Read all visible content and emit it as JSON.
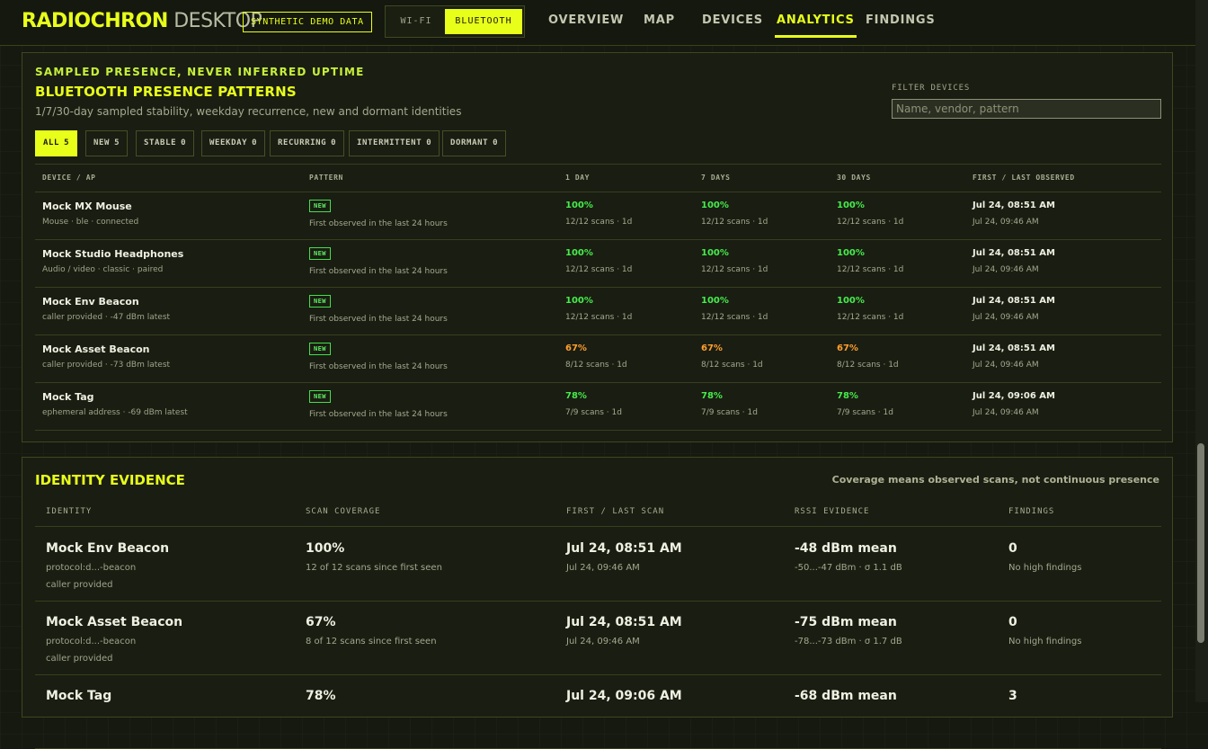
{
  "app": {
    "brand_primary": "RADIOCHRON",
    "brand_secondary": "DESKTOP",
    "demo_badge": "SYNTHETIC DEMO DATA",
    "radio_options": [
      "WI-FI",
      "BLUETOOTH"
    ],
    "radio_selected": "BLUETOOTH",
    "nav": [
      {
        "label": "OVERVIEW",
        "active": false
      },
      {
        "label": "MAP",
        "active": false
      },
      {
        "label": "DEVICES",
        "active": false
      },
      {
        "label": "ANALYTICS",
        "active": true
      },
      {
        "label": "FINDINGS",
        "active": false
      }
    ],
    "accent": "#e8ff1a",
    "good": "#46ec4c",
    "warn": "#ff9f2e"
  },
  "presence": {
    "eyebrow": "SAMPLED PRESENCE, NEVER INFERRED UPTIME",
    "title": "BLUETOOTH PRESENCE PATTERNS",
    "subtitle": "1/7/30-day sampled stability, weekday recurrence, new and dormant identities",
    "filter_label": "FILTER DEVICES",
    "filter_placeholder": "Name, vendor, pattern",
    "chips": [
      {
        "label": "ALL",
        "count": "5",
        "active": true
      },
      {
        "label": "NEW",
        "count": "5",
        "active": false
      },
      {
        "label": "STABLE",
        "count": "0",
        "active": false
      },
      {
        "label": "WEEKDAY",
        "count": "0",
        "active": false
      },
      {
        "label": "RECURRING",
        "count": "0",
        "active": false
      },
      {
        "label": "INTERMITTENT",
        "count": "0",
        "active": false
      },
      {
        "label": "DORMANT",
        "count": "0",
        "active": false
      }
    ],
    "columns": [
      "DEVICE / AP",
      "PATTERN",
      "1 DAY",
      "7 DAYS",
      "30 DAYS",
      "FIRST / LAST OBSERVED"
    ],
    "rows": [
      {
        "name": "Mock MX Mouse",
        "meta": "Mouse · ble · connected",
        "badge": "NEW",
        "pattern": "First observed in the last 24 hours",
        "d1": "100%",
        "d1s": "12/12 scans · 1d",
        "d7": "100%",
        "d7s": "12/12 scans · 1d",
        "d30": "100%",
        "d30s": "12/12 scans · 1d",
        "tone": "good",
        "first": "Jul 24, 08:51 AM",
        "last": "Jul 24, 09:46 AM"
      },
      {
        "name": "Mock Studio Headphones",
        "meta": "Audio / video · classic · paired",
        "badge": "NEW",
        "pattern": "First observed in the last 24 hours",
        "d1": "100%",
        "d1s": "12/12 scans · 1d",
        "d7": "100%",
        "d7s": "12/12 scans · 1d",
        "d30": "100%",
        "d30s": "12/12 scans · 1d",
        "tone": "good",
        "first": "Jul 24, 08:51 AM",
        "last": "Jul 24, 09:46 AM"
      },
      {
        "name": "Mock Env Beacon",
        "meta": "caller provided · -47 dBm latest",
        "badge": "NEW",
        "pattern": "First observed in the last 24 hours",
        "d1": "100%",
        "d1s": "12/12 scans · 1d",
        "d7": "100%",
        "d7s": "12/12 scans · 1d",
        "d30": "100%",
        "d30s": "12/12 scans · 1d",
        "tone": "good",
        "first": "Jul 24, 08:51 AM",
        "last": "Jul 24, 09:46 AM"
      },
      {
        "name": "Mock Asset Beacon",
        "meta": "caller provided · -73 dBm latest",
        "badge": "NEW",
        "pattern": "First observed in the last 24 hours",
        "d1": "67%",
        "d1s": "8/12 scans · 1d",
        "d7": "67%",
        "d7s": "8/12 scans · 1d",
        "d30": "67%",
        "d30s": "8/12 scans · 1d",
        "tone": "warn",
        "first": "Jul 24, 08:51 AM",
        "last": "Jul 24, 09:46 AM"
      },
      {
        "name": "Mock Tag",
        "meta": "ephemeral address · -69 dBm latest",
        "badge": "NEW",
        "pattern": "First observed in the last 24 hours",
        "d1": "78%",
        "d1s": "7/9 scans · 1d",
        "d7": "78%",
        "d7s": "7/9 scans · 1d",
        "d30": "78%",
        "d30s": "7/9 scans · 1d",
        "tone": "good",
        "first": "Jul 24, 09:06 AM",
        "last": "Jul 24, 09:46 AM"
      }
    ]
  },
  "identity": {
    "title": "IDENTITY EVIDENCE",
    "note": "Coverage means observed scans, not continuous presence",
    "columns": [
      "IDENTITY",
      "SCAN COVERAGE",
      "FIRST / LAST SCAN",
      "RSSI EVIDENCE",
      "FINDINGS"
    ],
    "rows": [
      {
        "name": "Mock Env Beacon",
        "protocol": "protocol:d...-beacon",
        "source": "caller provided",
        "coverage": "100%",
        "coverage_detail": "12 of 12 scans since first seen",
        "first": "Jul 24, 08:51 AM",
        "last": "Jul 24, 09:46 AM",
        "rssi": "-48 dBm mean",
        "rssi_detail": "-50...-47 dBm · σ 1.1 dB",
        "findings": "0",
        "findings_detail": "No high findings"
      },
      {
        "name": "Mock Asset Beacon",
        "protocol": "protocol:d...-beacon",
        "source": "caller provided",
        "coverage": "67%",
        "coverage_detail": "8 of 12 scans since first seen",
        "first": "Jul 24, 08:51 AM",
        "last": "Jul 24, 09:46 AM",
        "rssi": "-75 dBm mean",
        "rssi_detail": "-78...-73 dBm · σ 1.7 dB",
        "findings": "0",
        "findings_detail": "No high findings"
      },
      {
        "name": "Mock Tag",
        "protocol": "",
        "source": "",
        "coverage": "78%",
        "coverage_detail": "",
        "first": "Jul 24, 09:06 AM",
        "last": "",
        "rssi": "-68 dBm mean",
        "rssi_detail": "",
        "findings": "3",
        "findings_detail": ""
      }
    ]
  }
}
